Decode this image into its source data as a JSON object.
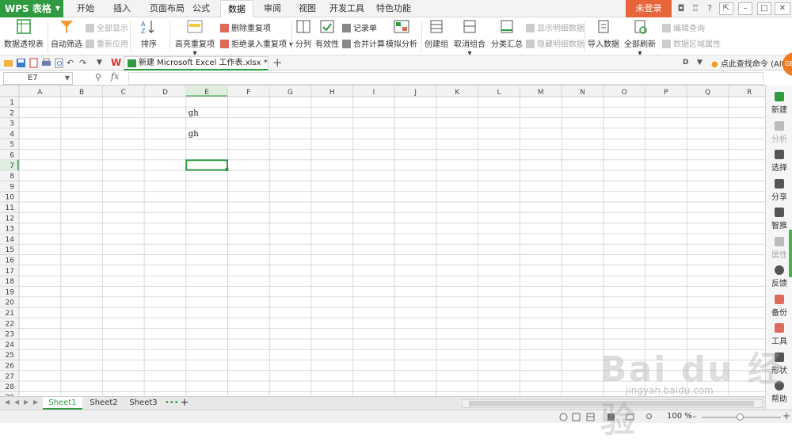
{
  "app": {
    "logo": "WPS 表格",
    "menu_tabs": [
      "开始",
      "插入",
      "页面布局",
      "公式",
      "数据",
      "审阅",
      "视图",
      "开发工具",
      "特色功能"
    ],
    "active_tab": "数据",
    "login": "未登录"
  },
  "ribbon": {
    "pivot": "数据透视表",
    "autofilter": "自动筛选",
    "show_all": "全部显示",
    "reapply": "重新应用",
    "sort": "排序",
    "highlight_dup": "高亮重复项 ▾",
    "remove_dup": "删除重复项",
    "reject_dup": "拒绝录入重复项 ▾",
    "split": "分列",
    "validity": "有效性",
    "record": "记录单",
    "consolidate": "合并计算",
    "whatif": "模拟分析",
    "group": "创建组",
    "ungroup": "取消组合 ▾",
    "subtotal": "分类汇总",
    "show_detail": "显示明细数据",
    "hide_detail": "隐藏明细数据",
    "import": "导入数据",
    "refresh_all": "全部刷新 ▾",
    "edit_query": "编辑查询",
    "range_props": "数据区域属性"
  },
  "doc_tab": {
    "title": "新建 Microsoft Excel 工作表.xlsx *",
    "add": "+",
    "find_command": "点此查找命令 (Alt+"
  },
  "badge": "GB",
  "formula_bar": {
    "name_box": "E7",
    "fx": "fx",
    "formula": ""
  },
  "grid": {
    "columns": [
      "A",
      "B",
      "C",
      "D",
      "E",
      "F",
      "G",
      "H",
      "I",
      "J",
      "K",
      "L",
      "M",
      "N",
      "O",
      "P",
      "Q",
      "R"
    ],
    "rows": [
      "1",
      "2",
      "3",
      "4",
      "5",
      "6",
      "7",
      "8",
      "9",
      "10",
      "11",
      "12",
      "13",
      "14",
      "15",
      "16",
      "17",
      "18",
      "19",
      "20",
      "21",
      "22",
      "23",
      "24",
      "25",
      "26",
      "27",
      "28",
      "29"
    ],
    "selected_cell": "E7",
    "cells": [
      {
        "ref": "E2",
        "value": "gh"
      },
      {
        "ref": "E4",
        "value": "gh"
      }
    ]
  },
  "right_panel": [
    "新建",
    "分析",
    "选择",
    "分享",
    "智推",
    "属性",
    "反馈",
    "备份",
    "工具",
    "形状",
    "帮助"
  ],
  "sheets": {
    "tabs": [
      "Sheet1",
      "Sheet2",
      "Sheet3"
    ],
    "active": "Sheet1",
    "more": "•••",
    "add": "+"
  },
  "status": {
    "zoom": "100 %"
  },
  "watermark": {
    "main": "Bai du 经验",
    "sub": "jingyan.baidu.com"
  },
  "colors": {
    "brand_green": "#2f9a3f",
    "login_orange": "#e8643a",
    "selection_green": "#2f9a3f"
  }
}
